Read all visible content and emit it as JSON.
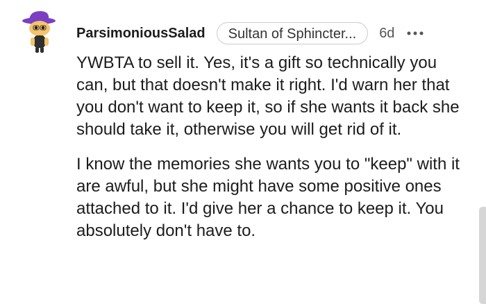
{
  "comment": {
    "username": "ParsimoniousSalad",
    "flair": "Sultan of Sphincter...",
    "timestamp": "6d",
    "more_icon": "more-options-icon",
    "avatar_icon": "snoo-avatar-icon",
    "paragraphs": [
      "YWBTA to sell it. Yes, it's a gift so technically you can, but that doesn't make it right. I'd warn her that you don't want to keep it, so if she wants it back she should take it, otherwise you will get rid of it.",
      "I know the memories she wants you to \"keep\" with it are awful, but she might have some positive ones attached to it. I'd give her a chance to keep it. You absolutely don't have to."
    ]
  },
  "colors": {
    "avatar_hat": "#7b3fc4",
    "avatar_skin": "#f4c46a",
    "avatar_shirt": "#2f2f2f",
    "text": "#1c1c1c",
    "flair_border": "#c9ccce"
  }
}
